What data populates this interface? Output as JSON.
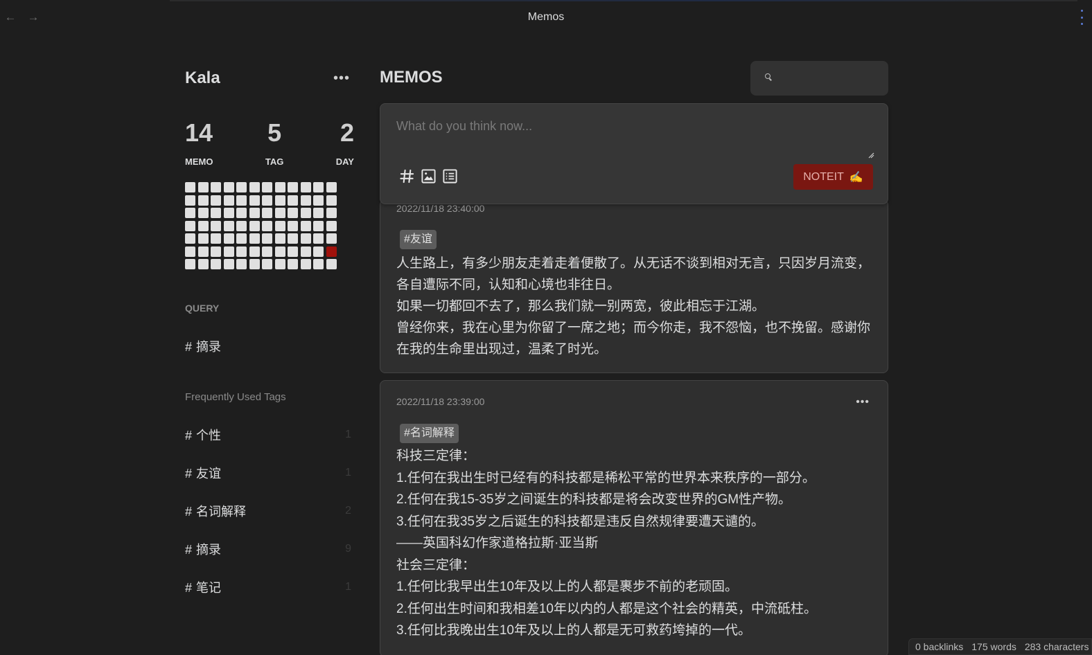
{
  "window": {
    "title": "Memos"
  },
  "sidebar": {
    "username": "Kala",
    "stats": [
      {
        "value": "14",
        "label": "MEMO"
      },
      {
        "value": "5",
        "label": "TAG"
      },
      {
        "value": "2",
        "label": "DAY"
      }
    ],
    "query_title": "QUERY",
    "query_items": [
      {
        "label": "摘录"
      }
    ],
    "tags_title": "Frequently Used Tags",
    "tags": [
      {
        "label": "个性",
        "count": "1"
      },
      {
        "label": "友谊",
        "count": "1"
      },
      {
        "label": "名词解释",
        "count": "2"
      },
      {
        "label": "摘录",
        "count": "9"
      },
      {
        "label": "笔记",
        "count": "1"
      }
    ],
    "heatmap": {
      "rows": 7,
      "cols": 12,
      "active_cell": {
        "row": 5,
        "col": 11
      },
      "active_color": "#a0110b"
    }
  },
  "main": {
    "title": "MEMOS",
    "search": {
      "placeholder": ""
    },
    "editor": {
      "placeholder": "What do you think now...",
      "submit_label": "NOTEIT",
      "submit_emoji": "✍️"
    },
    "memos": [
      {
        "date": "2022/11/18 23:40:00",
        "tag": "#友谊",
        "lines": [
          "人生路上，有多少朋友走着走着便散了。从无话不谈到相对无言，只因岁月流变，",
          "各自遭际不同，认知和心境也非往日。",
          "如果一切都回不去了，那么我们就一别两宽，彼此相忘于江湖。",
          "曾经你来，我在心里为你留了一席之地；而今你走，我不怨恼，也不挽留。感谢你",
          "在我的生命里出现过，温柔了时光。"
        ]
      },
      {
        "date": "2022/11/18 23:39:00",
        "tag": "#名词解释",
        "lines": [
          "科技三定律：",
          "1.任何在我出生时已经有的科技都是稀松平常的世界本来秩序的一部分。",
          "2.任何在我15-35岁之间诞生的科技都是将会改变世界的GM性产物。",
          "3.任何在我35岁之后诞生的科技都是违反自然规律要遭天谴的。",
          "——英国科幻作家道格拉斯·亚当斯",
          "社会三定律：",
          "1.任何比我早出生10年及以上的人都是裹步不前的老顽固。",
          "2.任何出生时间和我相差10年以内的人都是这个社会的精英，中流砥柱。",
          "3.任何比我晚出生10年及以上的人都是无可救药垮掉的一代。"
        ]
      }
    ]
  },
  "status_bar": {
    "backlinks": "0 backlinks",
    "words": "175 words",
    "characters": "283 characters"
  },
  "colors": {
    "accent": "#7a1711",
    "background": "#1e1e1e",
    "card": "#2f2f2f"
  }
}
